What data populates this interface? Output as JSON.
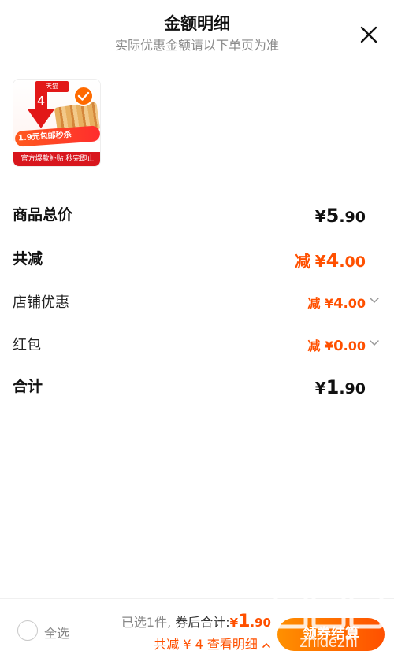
{
  "header": {
    "title": "金额明细",
    "subtitle": "实际优惠金额请以下单页为准"
  },
  "product": {
    "shop_tag": "天猫",
    "badge_number": "4",
    "banner": "1.9元包邮秒杀",
    "footer": "官方爆款补贴 秒完即止",
    "selected": true
  },
  "rows": {
    "goods_total": {
      "label": "商品总价",
      "yen": "¥",
      "int": "5",
      "dec": ".90"
    },
    "total_discount": {
      "label": "共减",
      "prefix": "减",
      "yen": "¥",
      "int": "4",
      "dec": ".00"
    },
    "shop_discount": {
      "label": "店铺优惠",
      "prefix": "减",
      "yen": "¥",
      "int": "4",
      "dec": ".00"
    },
    "red_packet": {
      "label": "红包",
      "prefix": "减",
      "yen": "¥",
      "int": "0",
      "dec": ".00"
    },
    "sum": {
      "label": "合计",
      "yen": "¥",
      "int": "1",
      "dec": ".90"
    }
  },
  "bottom_bar": {
    "select_all_label": "全选",
    "selected_count": "已选1件,",
    "after_coupon_label": "券后合计:",
    "total_yen": "¥",
    "total_int": "1",
    "total_dec": ".90",
    "detail_text": "共减 ¥ 4  查看明细",
    "checkout_label": "领券结算"
  },
  "watermark": {
    "text": "值 什么值得买"
  },
  "colors": {
    "accent": "#ff5000",
    "checkout_from": "#ff9000",
    "checkout_to": "#ff5000"
  }
}
